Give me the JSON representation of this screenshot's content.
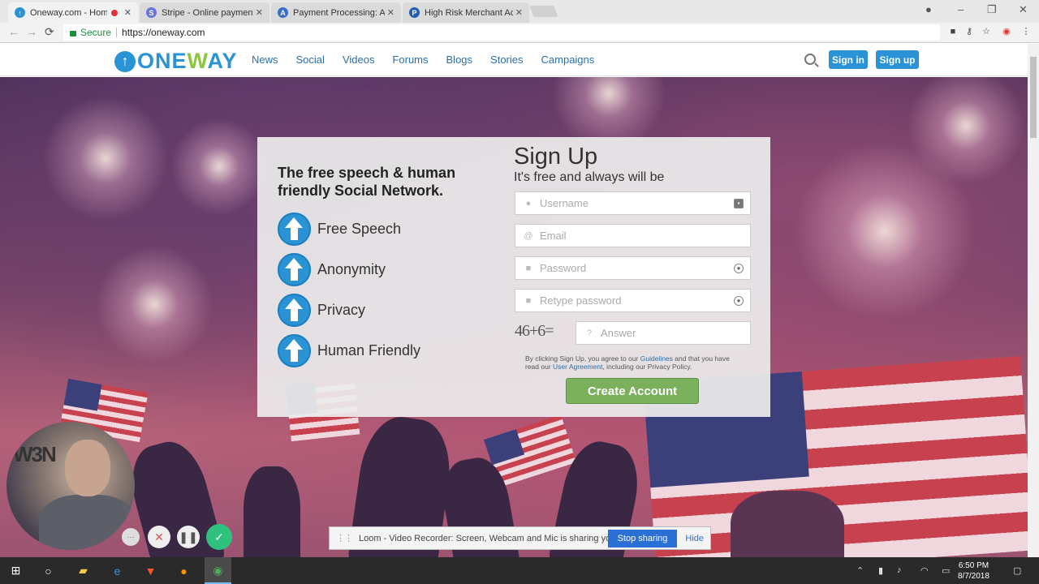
{
  "browser": {
    "tabs": [
      {
        "label": "Oneway.com - Home",
        "favicon": "oneway-favicon",
        "color": "#2a93d5",
        "recording": true
      },
      {
        "label": "Stripe - Online payment p",
        "favicon": "stripe-favicon",
        "color": "#6772e5",
        "glyph": "S"
      },
      {
        "label": "Payment Processing: Acc",
        "favicon": "paysite-favicon",
        "color": "#3a6cc9",
        "glyph": "A"
      },
      {
        "label": "High Risk Merchant Acco",
        "favicon": "paypal-favicon",
        "color": "#1e5fb4",
        "glyph": "P"
      }
    ],
    "secure_label": "Secure",
    "url": "https://oneway.com"
  },
  "site": {
    "logo_text_a": "ONE",
    "logo_text_b": "W",
    "logo_text_c": "AY",
    "nav": [
      "News",
      "Social",
      "Videos",
      "Forums",
      "Blogs",
      "Stories",
      "Campaigns"
    ],
    "signin_label": "Sign in",
    "signup_label": "Sign up"
  },
  "card": {
    "tagline": "The free speech & human friendly Social Network.",
    "features": [
      "Free Speech",
      "Anonymity",
      "Privacy",
      "Human Friendly"
    ],
    "title": "Sign Up",
    "subtitle": "It's free and always will be",
    "fields": {
      "username_placeholder": "Username",
      "email_placeholder": "Email",
      "password_placeholder": "Password",
      "retype_placeholder": "Retype password",
      "answer_placeholder": "Answer"
    },
    "captcha": "46+6=",
    "terms_a": "By clicking Sign Up, you agree to our ",
    "terms_link1": "Guidelines",
    "terms_b": " and that you have read our ",
    "terms_link2": "User Agreement",
    "terms_c": ", including our Privacy Policy.",
    "create_label": "Create Account"
  },
  "loom": {
    "message": "Loom - Video Recorder: Screen, Webcam and Mic is sharing your screen.",
    "stop_label": "Stop sharing",
    "hide_label": "Hide",
    "cam_sign": "W3N"
  },
  "taskbar": {
    "time": "6:50 PM",
    "date": "8/7/2018"
  },
  "colors": {
    "brand_blue": "#2a93d5",
    "brand_green": "#8cc63f",
    "create_green": "#7bb05d"
  }
}
